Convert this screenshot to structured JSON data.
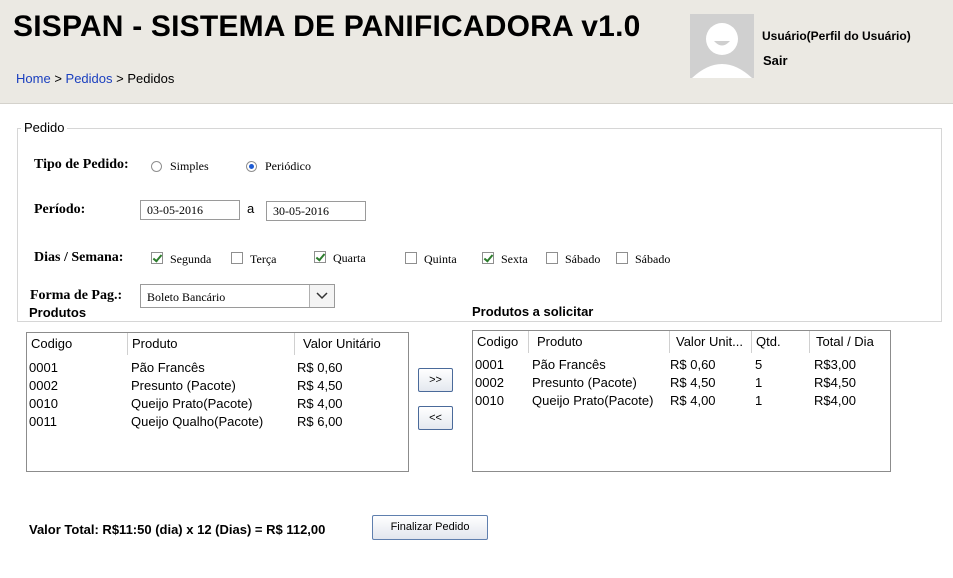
{
  "header": {
    "title": "SISPAN - SISTEMA DE PANIFICADORA v1.0",
    "breadcrumb": {
      "home": "Home",
      "sep1": ">",
      "pedidos": "Pedidos",
      "sep2": ">",
      "current": "Pedidos"
    },
    "user_label": "Usuário(Perfil do Usuário)",
    "logout": "Sair"
  },
  "form": {
    "legend": "Pedido",
    "tipo_label": "Tipo de Pedido:",
    "tipo_options": [
      {
        "label": "Simples",
        "selected": false
      },
      {
        "label": "Periódico",
        "selected": true
      }
    ],
    "periodo_label": "Período:",
    "periodo_start": "03-05-2016",
    "periodo_sep": "a",
    "periodo_end": "30-05-2016",
    "dias_label": "Dias / Semana:",
    "dias": [
      {
        "label": "Segunda",
        "checked": true
      },
      {
        "label": "Terça",
        "checked": false
      },
      {
        "label": "Quarta",
        "checked": true
      },
      {
        "label": "Quinta",
        "checked": false
      },
      {
        "label": "Sexta",
        "checked": true
      },
      {
        "label": "Sábado",
        "checked": false
      },
      {
        "label": "Sábado",
        "checked": false
      }
    ],
    "pagamento_label": "Forma de Pag.:",
    "pagamento_value": "Boleto Bancário"
  },
  "produtos": {
    "title": "Produtos",
    "headers": [
      "Codigo",
      "Produto",
      "Valor Unitário"
    ],
    "rows": [
      [
        "0001",
        "Pão Francês",
        "R$ 0,60"
      ],
      [
        "0002",
        "Presunto (Pacote)",
        "R$ 4,50"
      ],
      [
        "0010",
        "Queijo Prato(Pacote)",
        "R$ 4,00"
      ],
      [
        "0011",
        "Queijo Qualho(Pacote)",
        "R$ 6,00"
      ]
    ]
  },
  "buttons": {
    "add": ">>",
    "remove": "<<",
    "finish": "Finalizar Pedido"
  },
  "solicitar": {
    "title": "Produtos a solicitar",
    "headers": [
      "Codigo",
      "Produto",
      "Valor Unit...",
      "Qtd.",
      "Total / Dia"
    ],
    "rows": [
      [
        "0001",
        "Pão Francês",
        "R$ 0,60",
        "5",
        "R$3,00"
      ],
      [
        "0002",
        "Presunto (Pacote)",
        "R$ 4,50",
        "1",
        "R$4,50"
      ],
      [
        "0010",
        "Queijo Prato(Pacote)",
        "R$ 4,00",
        "1",
        "R$4,00"
      ]
    ]
  },
  "total_text": "Valor Total: R$11:50 (dia) x 12 (Dias) =  R$ 112,00"
}
